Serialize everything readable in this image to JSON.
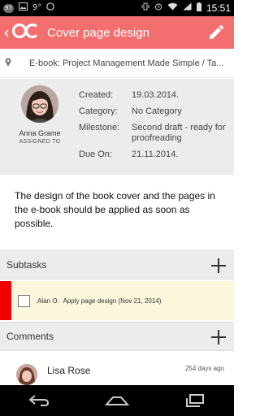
{
  "status_bar": {
    "badge": "97",
    "temperature": "9°",
    "time": "15:51",
    "icons": [
      "notification-badge-icon",
      "image-icon",
      "weather-icon",
      "chat-icon",
      "vibrate-icon",
      "alarm-icon",
      "wifi-icon",
      "signal-icon",
      "battery-icon"
    ]
  },
  "app_bar": {
    "title": "Cover page design",
    "logo": "oc-logo",
    "background_color": "#f36f6f"
  },
  "project": {
    "name": "E-book: Project Management Made Simple / Ta..."
  },
  "details": {
    "assignee_name": "Anna Grame",
    "assigned_to_label": "ASSIGNED TO",
    "fields": [
      {
        "label": "Created:",
        "value": "19.03.2014."
      },
      {
        "label": "Category:",
        "value": "No Category"
      },
      {
        "label": "Milestone:",
        "value": "Second draft - ready for proofreading"
      },
      {
        "label": "Due On:",
        "value": "21.11.2014."
      }
    ]
  },
  "description": "The design of the book cover and the pages in the e-book should be applied as soon as possible.",
  "subtasks": {
    "header": "Subtasks",
    "items": [
      {
        "assignee": "Alan O.",
        "text": "Apply page design (Nov 21, 2014)",
        "priority_color": "#f20000"
      }
    ]
  },
  "comments": {
    "header": "Comments",
    "items": [
      {
        "author": "Lisa Rose",
        "time": "254 days ago"
      }
    ]
  }
}
